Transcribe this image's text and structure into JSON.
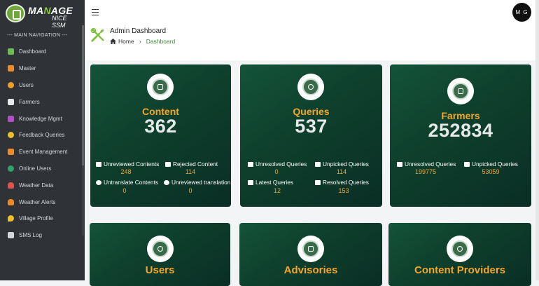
{
  "brand": {
    "line1_a": "MA",
    "line1_b": "N",
    "line1_c": "AGE",
    "line2": "NICE SSM"
  },
  "sidebar": {
    "section_title": "--- MAIN NAVIGATION ---",
    "items": [
      {
        "label": "Dashboard",
        "icon": "home-icon",
        "color": "#6cbf4a"
      },
      {
        "label": "Master",
        "icon": "users-cog-icon",
        "color": "#f08a24"
      },
      {
        "label": "Users",
        "icon": "user-circle-icon",
        "color": "#f0a024"
      },
      {
        "label": "Farmers",
        "icon": "tractor-icon",
        "color": "#e7e9eb"
      },
      {
        "label": "Knowledge Mgmt",
        "icon": "book-icon",
        "color": "#b44fc7"
      },
      {
        "label": "Feedback Queries",
        "icon": "question-icon",
        "color": "#f0c024"
      },
      {
        "label": "Event Management",
        "icon": "calendar-icon",
        "color": "#f08a24"
      },
      {
        "label": "Online Users",
        "icon": "globe-icon",
        "color": "#2fa36b"
      },
      {
        "label": "Weather Data",
        "icon": "cloud-icon",
        "color": "#e0524a"
      },
      {
        "label": "Weather Alerts",
        "icon": "cloud-alert-icon",
        "color": "#f08a24"
      },
      {
        "label": "Village Profile",
        "icon": "map-pin-icon",
        "color": "#f0c024"
      },
      {
        "label": "SMS Log",
        "icon": "message-icon",
        "color": "#d4d6d8"
      }
    ]
  },
  "topbar": {
    "avatar_initials": "M G"
  },
  "header": {
    "title": "Admin Dashboard",
    "crumb_home": "Home",
    "crumb_sep": "›",
    "crumb_active": "Dashboard"
  },
  "cards": {
    "content": {
      "title": "Content",
      "value": "362",
      "stats": [
        {
          "label": "Unreviewed Contents",
          "value": "248"
        },
        {
          "label": "Rejected Content",
          "value": "114"
        },
        {
          "label": "Untranslate Contents",
          "value": "0"
        },
        {
          "label": "Unreviewed translation",
          "value": "0"
        }
      ]
    },
    "queries": {
      "title": "Queries",
      "value": "537",
      "stats": [
        {
          "label": "Unresolved Queries",
          "value": "0"
        },
        {
          "label": "Unpicked Queries",
          "value": "114"
        },
        {
          "label": "Latest Queries",
          "value": "12"
        },
        {
          "label": "Resolved Queries",
          "value": "153"
        }
      ]
    },
    "farmers": {
      "title": "Farmers",
      "value": "252834",
      "stats": [
        {
          "label": "Unresolved Queries",
          "value": "199775"
        },
        {
          "label": "Unpicked Queries",
          "value": "53059"
        }
      ]
    },
    "users": {
      "title": "Users"
    },
    "advisories": {
      "title": "Advisories"
    },
    "content_providers": {
      "title": "Content Providers"
    }
  }
}
